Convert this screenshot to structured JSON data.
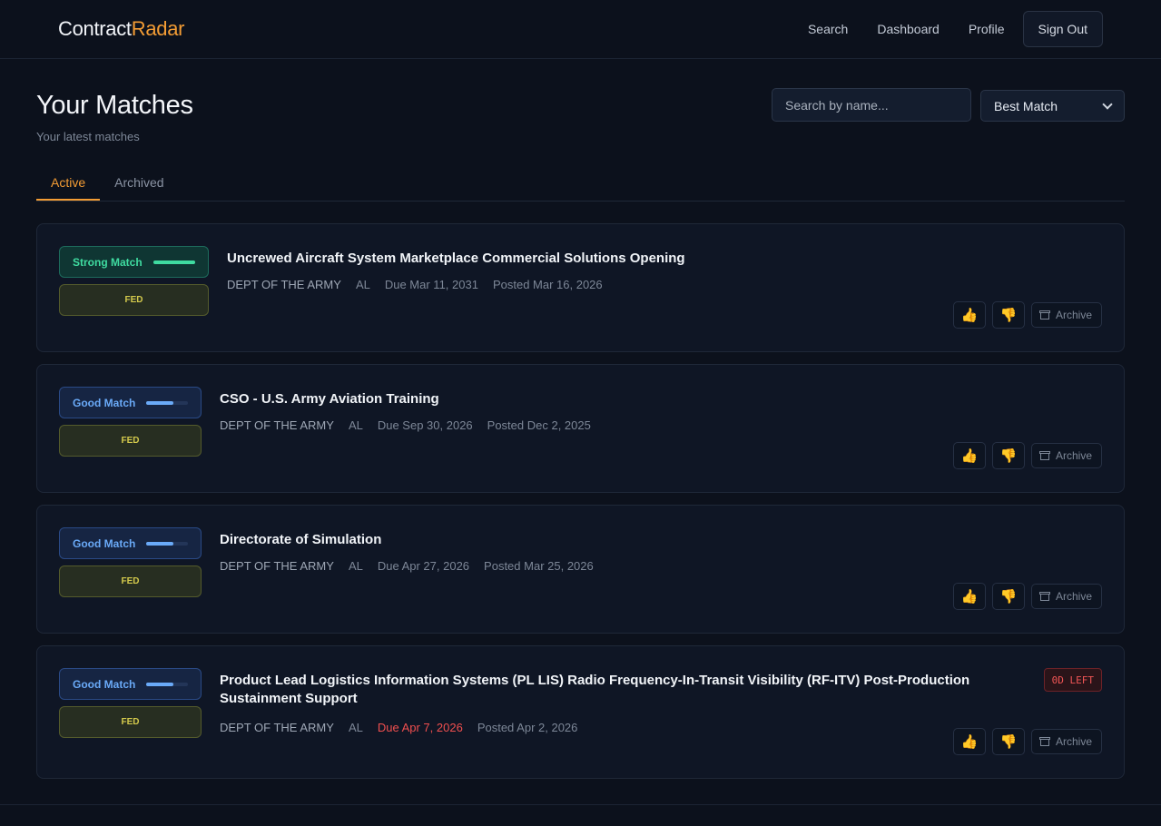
{
  "brand": {
    "part1": "Contract",
    "part2": "Radar"
  },
  "nav": {
    "search": "Search",
    "dashboard": "Dashboard",
    "profile": "Profile",
    "signout": "Sign Out"
  },
  "page": {
    "title": "Your Matches",
    "subtitle": "Your latest matches"
  },
  "filters": {
    "search_placeholder": "Search by name...",
    "sort_selected": "Best Match"
  },
  "tabs": {
    "active": "Active",
    "archived": "Archived"
  },
  "colors": {
    "accent": "#f39c34",
    "strong": "#3fdba0",
    "good": "#6aaaf8",
    "fed": "#d3c94c",
    "urgent": "#f04f4f"
  },
  "matches": [
    {
      "match_label": "Strong Match",
      "match_level": 1.0,
      "type": "FED",
      "title": "Uncrewed Aircraft System Marketplace Commercial Solutions Opening",
      "agency": "DEPT OF THE ARMY",
      "state": "AL",
      "due": "Due Mar 11, 2031",
      "posted": "Posted Mar 16, 2026",
      "archive_label": "Archive"
    },
    {
      "match_label": "Good Match",
      "match_level": 0.65,
      "type": "FED",
      "title": "CSO - U.S. Army Aviation Training",
      "agency": "DEPT OF THE ARMY",
      "state": "AL",
      "due": "Due Sep 30, 2026",
      "posted": "Posted Dec 2, 2025",
      "archive_label": "Archive"
    },
    {
      "match_label": "Good Match",
      "match_level": 0.65,
      "type": "FED",
      "title": "Directorate of Simulation",
      "agency": "DEPT OF THE ARMY",
      "state": "AL",
      "due": "Due Apr 27, 2026",
      "posted": "Posted Mar 25, 2026",
      "archive_label": "Archive"
    },
    {
      "match_label": "Good Match",
      "match_level": 0.65,
      "type": "FED",
      "title": "Product Lead Logistics Information Systems (PL LIS) Radio Frequency-In-Transit Visibility (RF-ITV) Post-Production Sustainment Support",
      "agency": "DEPT OF THE ARMY",
      "state": "AL",
      "due": "Due Apr 7, 2026",
      "posted": "Posted Apr 2, 2026",
      "days_left": "0D LEFT",
      "archive_label": "Archive"
    }
  ],
  "icons": {
    "like": "thumbs-up-icon",
    "dislike": "thumbs-down-icon",
    "archive": "archive-box-icon",
    "select": "chevron-down-icon"
  }
}
